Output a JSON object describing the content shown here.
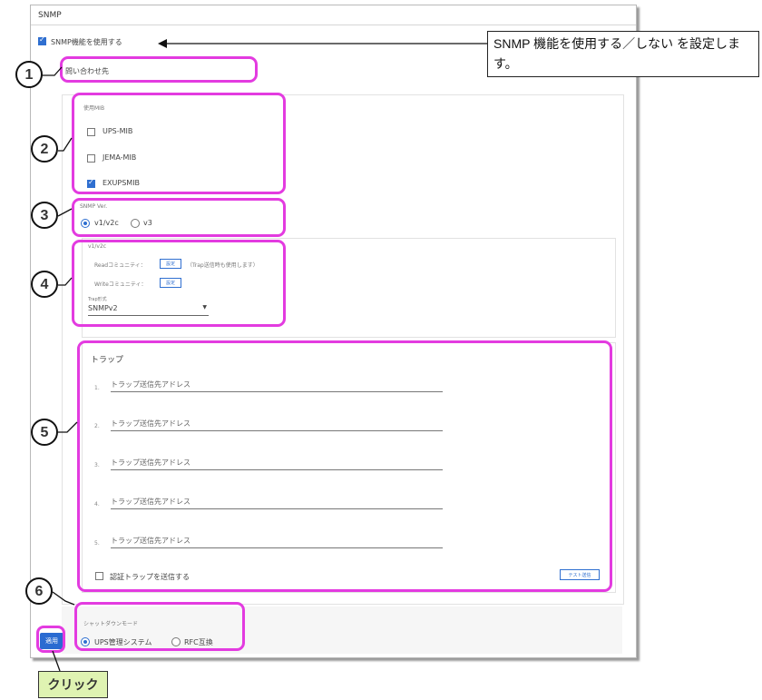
{
  "panel": {
    "title": "SNMP"
  },
  "enable": {
    "label": "SNMP機能を使用する",
    "checked": true
  },
  "inquiry": {
    "label": "問い合わせ先"
  },
  "mib": {
    "section_label": "使用MIB",
    "items": [
      {
        "label": "UPS-MIB",
        "checked": false
      },
      {
        "label": "JEMA-MIB",
        "checked": false
      },
      {
        "label": "EXUPSMIB",
        "checked": true
      }
    ]
  },
  "version": {
    "section_label": "SNMP Ver.",
    "options": [
      {
        "label": "v1/v2c",
        "selected": true
      },
      {
        "label": "v3",
        "selected": false
      }
    ]
  },
  "v1v2c": {
    "title": "v1/v2c",
    "read_label": "Readコミュニティ：",
    "read_button": "設定",
    "read_note": "（Trap送信時も使用します）",
    "write_label": "Writeコミュニティ：",
    "write_button": "設定",
    "trap_type_label": "Trap形式",
    "trap_type_value": "SNMPv2"
  },
  "trap": {
    "title": "トラップ",
    "items": [
      {
        "index": "1.",
        "placeholder": "トラップ送信先アドレス"
      },
      {
        "index": "2.",
        "placeholder": "トラップ送信先アドレス"
      },
      {
        "index": "3.",
        "placeholder": "トラップ送信先アドレス"
      },
      {
        "index": "4.",
        "placeholder": "トラップ送信先アドレス"
      },
      {
        "index": "5.",
        "placeholder": "トラップ送信先アドレス"
      }
    ],
    "auth_label": "認証トラップを送信する",
    "test_button": "テスト送信"
  },
  "shutdown": {
    "section_label": "シャットダウンモード",
    "options": [
      {
        "label": "UPS管理システム",
        "selected": true
      },
      {
        "label": "RFC互換",
        "selected": false
      }
    ]
  },
  "apply_button": "適用",
  "annotations": {
    "callout": "SNMP 機能を使用する／しない を設定します。",
    "click": "クリック",
    "numbers": [
      "1",
      "2",
      "3",
      "4",
      "5",
      "6"
    ],
    "accent_color": "#e33be0"
  }
}
